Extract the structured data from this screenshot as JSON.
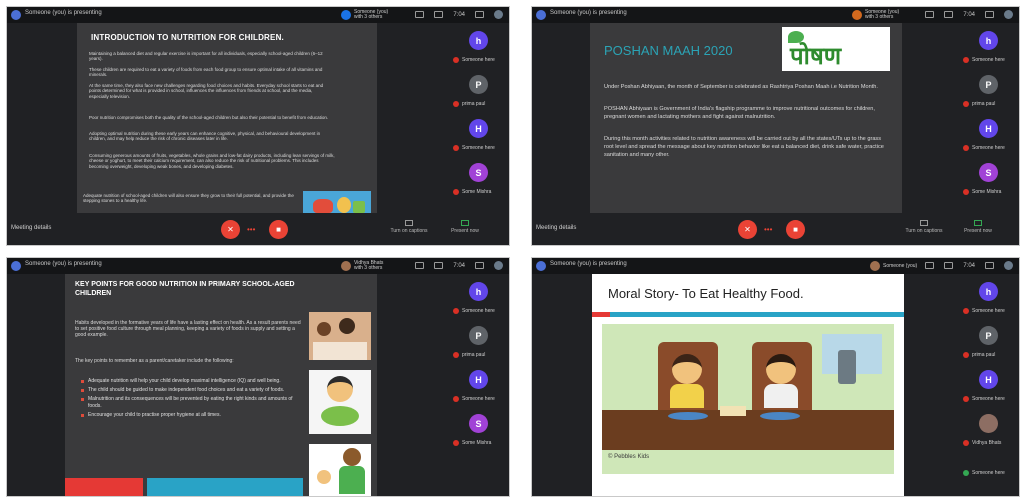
{
  "colors": {
    "meet_dark": "#202124",
    "mic_off_red": "#ea4335",
    "avatar_h": "#6246ea",
    "avatar_p": "#5f6368",
    "avatar_s": "#a142d6",
    "poshan_title": "#2ba3b5",
    "poshan_green": "#2e8b2e"
  },
  "shared": {
    "presenting_text": "Someone (you) is presenting",
    "meeting_details": "Meeting details",
    "turn_on_captions": "Turn on captions",
    "present_now": "Present now",
    "participants": [
      {
        "initial": "h",
        "name": "Someone here"
      },
      {
        "initial": "P",
        "name": "prima paul"
      },
      {
        "initial": "H",
        "name": "Someone here"
      },
      {
        "initial": "S",
        "name": "Some Mishra"
      }
    ],
    "participant_photo_name": "Vidhya Bhats",
    "time": "7:04",
    "count": "4"
  },
  "panel1": {
    "speaker_label": "Someone (you)\nwith 3 others",
    "title": "INTRODUCTION TO NUTRITION FOR CHILDREN.",
    "paragraphs": [
      "Maintaining a balanced diet and regular exercise is important for all individuals, especially school-aged children (6–12 years).",
      "These children are required to eat a variety of foods from each food group to ensure optimal intake of all vitamins and minerals.",
      "At the same time, they also face new challenges regarding food choices and habits. Everyday school starts to eat and points determined for what is provided in school, influences the influences from friends at school, and the media, especially television.",
      "Poor nutrition compromises both the quality of the school-aged children but also their potential to benefit from education.",
      "Adopting optimal nutrition during these early years can enhance cognitive, physical, and behavioural development in children, and may help reduce the risk of chronic diseases later in life.",
      "Consuming generous amounts of fruits, vegetables, whole grains and low-fat dairy products, including lean servings of milk, cheese or yoghurt, to meet their calcium requirement, can also reduce the risk of nutritional problems. This includes becoming overweight, developing weak bones, and developing diabetes.",
      "Adequate nutrition of school-aged children will also ensure they grow to their full potential, and provide the stepping stones to a healthy life."
    ]
  },
  "panel2": {
    "speaker_label": "Someone (you)\nwith 3 others",
    "title": "POSHAN MAAH 2020",
    "logo_text": "पोषण",
    "paragraphs": [
      "Under Poshan Abhiyaan, the month of September is celebrated as Rashtriya Poshan Maah i.e Nutrition Month.",
      "POSHAN Abhiyaan is Government of India's flagship programme to improve nutritional outcomes for children, pregnant women and lactating mothers and fight against malnutrition.",
      "During this month activities related to nutrition awareness will be carried out by all the states/UTs up to the grass root level and spread the message about key nutrition behavior like eat a balanced diet, drink safe water, practice sanitation and many other."
    ],
    "highlight": "Rashtriya Poshan Maah"
  },
  "panel3": {
    "speaker_label": "Vidhya Bhats\nwith 3 others",
    "title": "KEY POINTS FOR GOOD NUTRITION IN PRIMARY SCHOOL-AGED CHILDREN",
    "intro": "Habits developed in the formative years of life have a lasting effect on health. As a result parents need to set positive food culture through meal planning, keeping a variety of foods in supply and setting a good example.",
    "list_intro": "The key points to remember as a parent/caretaker include the following:",
    "bullets": [
      "Adequate nutrition will help your child develop maximal intelligence (IQ) and well being.",
      "The child should be guided to make independent food choices and eat a variety of foods.",
      "Malnutrition and its consequences will be prevented by eating the right kinds and amounts of foods.",
      "Encourage your child to practise proper hygiene at all times."
    ]
  },
  "panel4": {
    "speaker_label": "Someone (you)",
    "title": "Moral Story- To Eat Healthy Food.",
    "watermark": "© Pebbles Kids",
    "participants_extra_name": "Someone here"
  }
}
